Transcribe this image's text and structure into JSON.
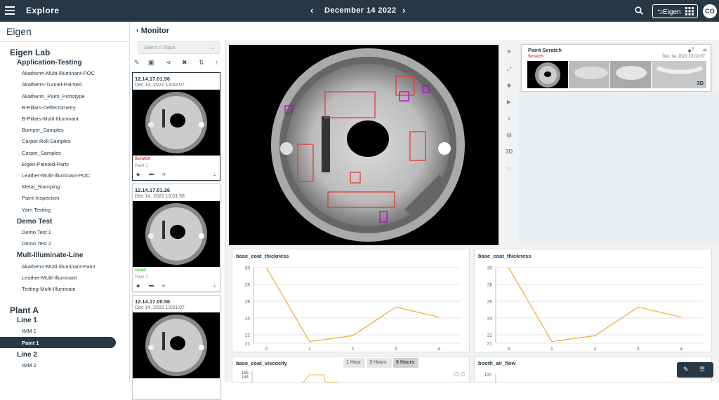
{
  "topbar": {
    "title": "Explore",
    "date": "December 14 2022",
    "prev": "‹",
    "next": "›",
    "brand_button": "Eigen",
    "avatar": "CO"
  },
  "sidebar": {
    "title": "Eigen",
    "tree": [
      {
        "level": 0,
        "label": "Eigen Lab"
      },
      {
        "level": 1,
        "label": "Application-Testing"
      },
      {
        "level": 2,
        "label": "Akatherm-Multi-Illuminant-POC"
      },
      {
        "level": 2,
        "label": "Akatherm-Tunnel-Painted"
      },
      {
        "level": 2,
        "label": "Akatherm_Paint_Prototype"
      },
      {
        "level": 2,
        "label": "B-Pillars-Deflectometry"
      },
      {
        "level": 2,
        "label": "B-Pillars-Multi-Illuminant"
      },
      {
        "level": 2,
        "label": "Bumper_Samples"
      },
      {
        "level": 2,
        "label": "Carpet-Roll-Samples"
      },
      {
        "level": 2,
        "label": "Carpet_Samples"
      },
      {
        "level": 2,
        "label": "Eigen-Painted-Parts"
      },
      {
        "level": 2,
        "label": "Leather-Multi-Illuminant-POC"
      },
      {
        "level": 2,
        "label": "Metal_Stamping"
      },
      {
        "level": 2,
        "label": "Paint Inspection"
      },
      {
        "level": 2,
        "label": "Yarn Testing"
      },
      {
        "level": 1,
        "label": "Demo Test"
      },
      {
        "level": 2,
        "label": "Demo Test 1"
      },
      {
        "level": 2,
        "label": "Demo Test 2"
      },
      {
        "level": 1,
        "label": "Mult-Illuminate-Line"
      },
      {
        "level": 2,
        "label": "Akatherm-Multi-Illuminant-Paint"
      },
      {
        "level": 2,
        "label": "Leather-Multi-Illuminant"
      },
      {
        "level": 2,
        "label": "Testing-Multi-Illuminate"
      },
      {
        "level": 0,
        "label": "Plant A"
      },
      {
        "level": 1,
        "label": "Line 1"
      },
      {
        "level": 2,
        "label": "IMM 1"
      },
      {
        "level": 2,
        "label": "Paint 1",
        "selected": true
      },
      {
        "level": 1,
        "label": "Line 2"
      },
      {
        "level": 2,
        "label": "IMM 2"
      }
    ]
  },
  "monitor": {
    "title": "Monitor",
    "stack_placeholder": "Select A Stack"
  },
  "cards": [
    {
      "id": "12.14.17.01.56",
      "time": "Dec 14, 2022 13:02:07",
      "status": "Scratch",
      "status_color": "#e53935",
      "part": "Paint 1"
    },
    {
      "id": "12.14.17.01.26",
      "time": "Dec 14, 2022 13:01:38",
      "status": "Good",
      "status_color": "#43c943",
      "part": "Paint 1"
    },
    {
      "id": "12.14.17.00.56",
      "time": "Dec 14, 2022 13:01:07"
    }
  ],
  "info": {
    "title": "Paint Scratch",
    "label": "Scratch",
    "time": "Dec 14, 2022 13:02:07",
    "view3d": "3D",
    "count": "0"
  },
  "viewtools": {
    "view3d": "3D"
  },
  "charts": [
    {
      "title": "base_coat_thickness",
      "chart_data": {
        "type": "line",
        "x": [
          0,
          1,
          2,
          3,
          4
        ],
        "y": [
          30,
          21.2,
          21.9,
          25.3,
          24.1
        ],
        "yticks": [
          21,
          22,
          24,
          26,
          28,
          30
        ],
        "ylim": [
          21,
          30
        ],
        "color": "#f0b040"
      }
    },
    {
      "title": "base_coat_thickness",
      "chart_data": {
        "type": "line",
        "x": [
          0,
          1,
          2,
          3,
          4
        ],
        "y": [
          30,
          21.2,
          21.9,
          25.3,
          24.1
        ],
        "yticks": [
          21,
          22,
          24,
          26,
          28,
          30
        ],
        "ylim": [
          21,
          30
        ],
        "color": "#f0b040"
      }
    },
    {
      "title": "base_coat_viscocity",
      "buttons": [
        "1 Hour",
        "3 Hours",
        "6 Hours"
      ],
      "visible_ticks": [
        "185",
        "184"
      ]
    },
    {
      "title": "booth_air_flow",
      "visible_ticks": [
        "120"
      ]
    }
  ]
}
